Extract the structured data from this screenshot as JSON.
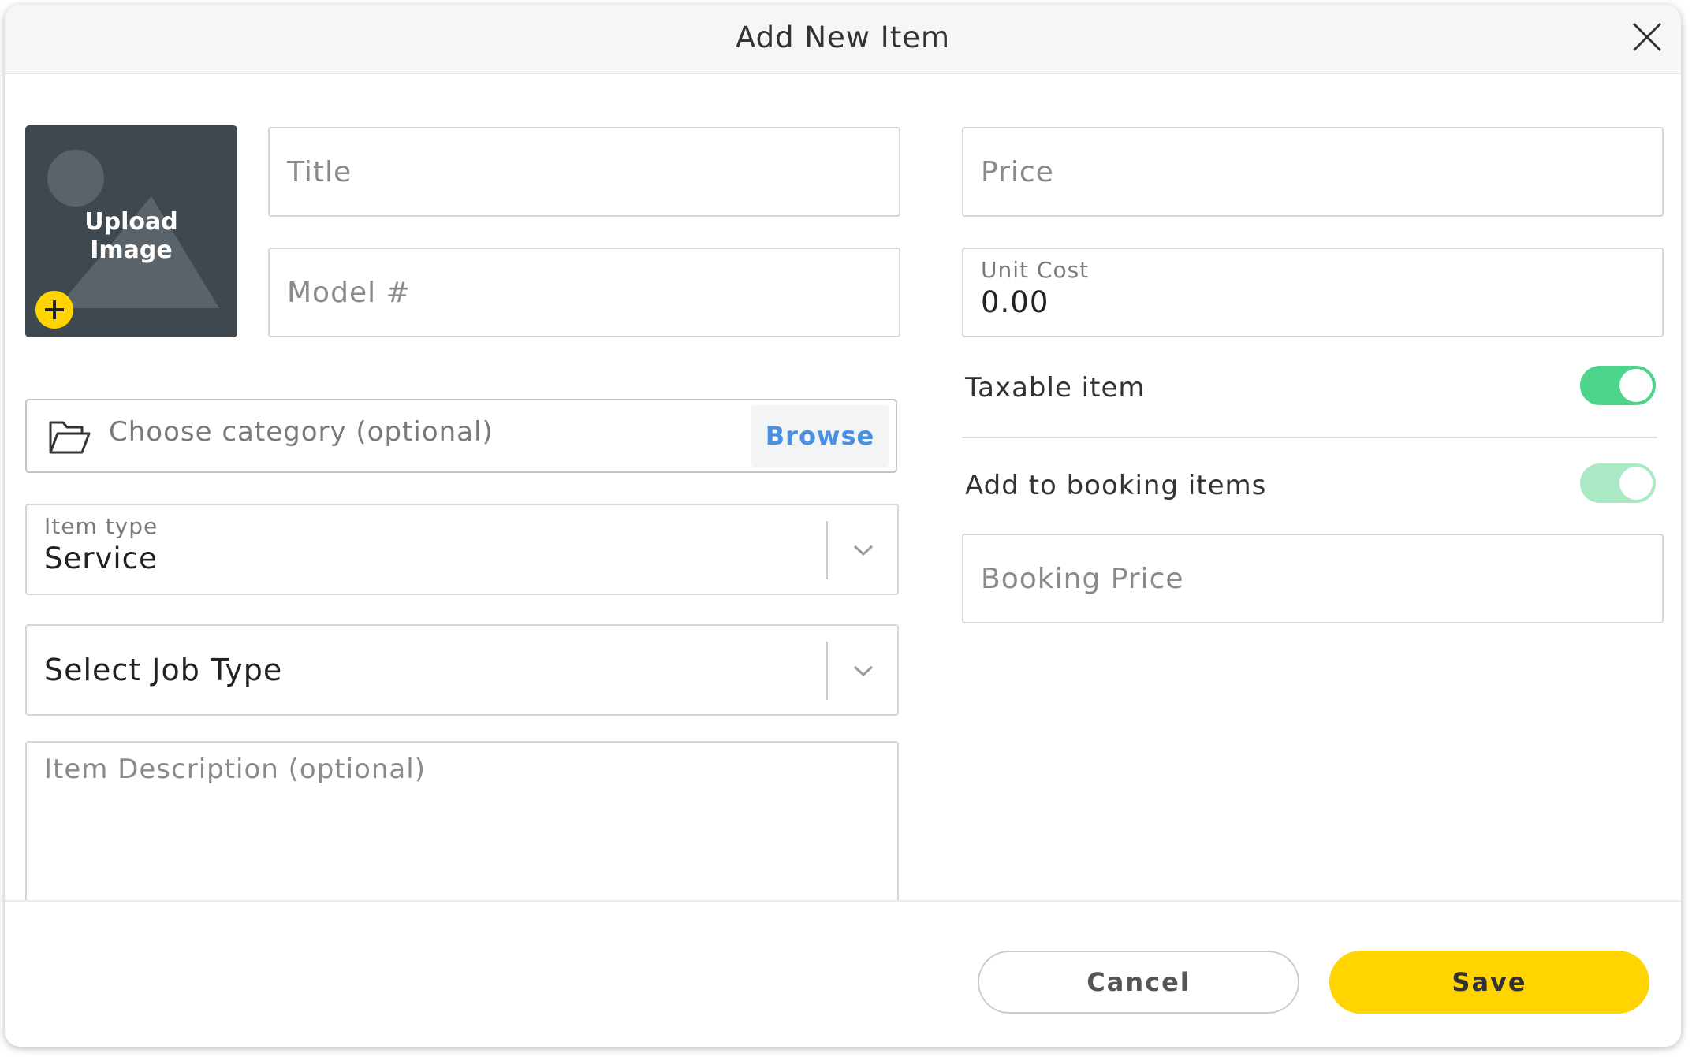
{
  "dialog": {
    "title": "Add New Item",
    "close_icon": "close-icon"
  },
  "upload": {
    "label": "Upload\nImage",
    "icon": "image-placeholder-icon",
    "add_icon": "plus-icon"
  },
  "fields": {
    "title_placeholder": "Title",
    "model_placeholder": "Model #",
    "price_placeholder": "Price",
    "unit_cost_label": "Unit Cost",
    "unit_cost_value": "0.00",
    "booking_price_placeholder": "Booking Price",
    "description_placeholder": "Item Description (optional)"
  },
  "category": {
    "icon": "folder-open-icon",
    "placeholder": "Choose category (optional)",
    "browse_label": "Browse"
  },
  "item_type": {
    "label": "Item type",
    "value": "Service"
  },
  "job_type": {
    "value": "Select Job Type"
  },
  "toggles": {
    "taxable": {
      "label": "Taxable item",
      "on": true,
      "color": "#4cd58a"
    },
    "booking": {
      "label": "Add to booking items",
      "on": true,
      "disabled": true,
      "color": "#a9e9c4"
    }
  },
  "footer": {
    "cancel_label": "Cancel",
    "save_label": "Save",
    "save_color": "#ffd400"
  }
}
